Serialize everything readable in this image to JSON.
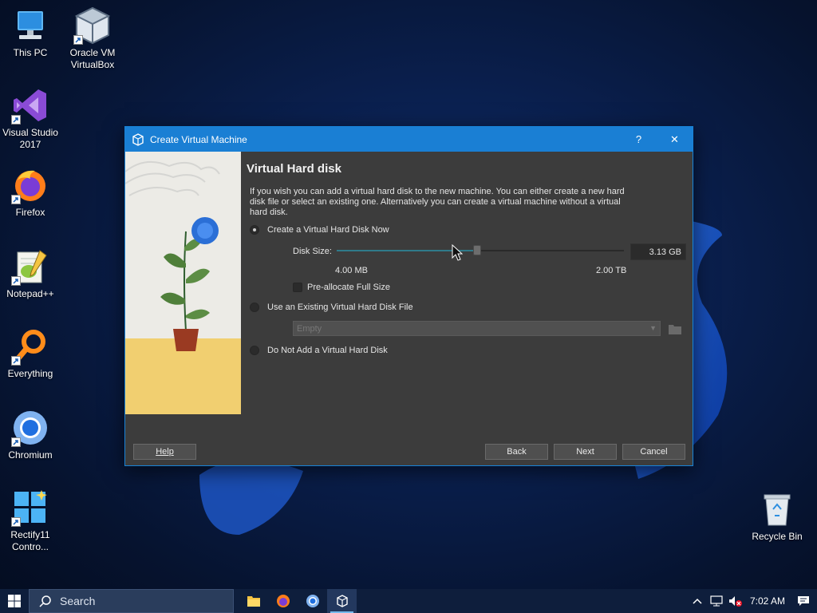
{
  "desktop": {
    "icons": [
      {
        "label": "This PC",
        "icon": "computer-icon"
      },
      {
        "label": "Oracle VM\nVirtualBox",
        "icon": "virtualbox-icon"
      },
      {
        "label": "Visual Studio\n2017",
        "icon": "visual-studio-icon"
      },
      {
        "label": "Firefox",
        "icon": "firefox-icon"
      },
      {
        "label": "Notepad++",
        "icon": "notepad-plus-plus-icon"
      },
      {
        "label": "Everything",
        "icon": "everything-search-icon"
      },
      {
        "label": "Chromium",
        "icon": "chromium-icon"
      },
      {
        "label": "Rectify11\nContro...",
        "icon": "control-panel-icon"
      },
      {
        "label": "Recycle Bin",
        "icon": "recycle-bin-icon"
      }
    ]
  },
  "dialog": {
    "title": "Create Virtual Machine",
    "help_glyph": "?",
    "close_glyph": "✕",
    "heading": "Virtual Hard disk",
    "description": "If you wish you can add a virtual hard disk to the new machine. You can either create a new hard disk file or select an existing one. Alternatively you can create a virtual machine without a virtual hard disk.",
    "options": {
      "create_now": "Create a Virtual Hard Disk Now",
      "use_existing": "Use an Existing Virtual Hard Disk File",
      "do_not_add": "Do Not Add a Virtual Hard Disk"
    },
    "selected_option": "create_now",
    "disk_size": {
      "label": "Disk Size:",
      "value": "3.13 GB",
      "min_label": "4.00 MB",
      "max_label": "2.00 TB",
      "slider_fraction": 0.49
    },
    "preallocate": {
      "label": "Pre-allocate Full Size",
      "checked": false
    },
    "existing_file_combo": {
      "value": "Empty",
      "enabled": false
    },
    "buttons": {
      "help": "Help",
      "back": "Back",
      "next": "Next",
      "cancel": "Cancel"
    }
  },
  "taskbar": {
    "search_placeholder": "Search",
    "apps": [
      "file-explorer-icon",
      "firefox-icon",
      "chromium-icon",
      "virtualbox-icon"
    ],
    "active_app": "virtualbox-icon",
    "clock": "7:02 AM"
  },
  "colors": {
    "accent": "#1a7fd4",
    "dialog_bg": "#3c3c3c",
    "taskbar_bg": "#0e1e3c"
  }
}
